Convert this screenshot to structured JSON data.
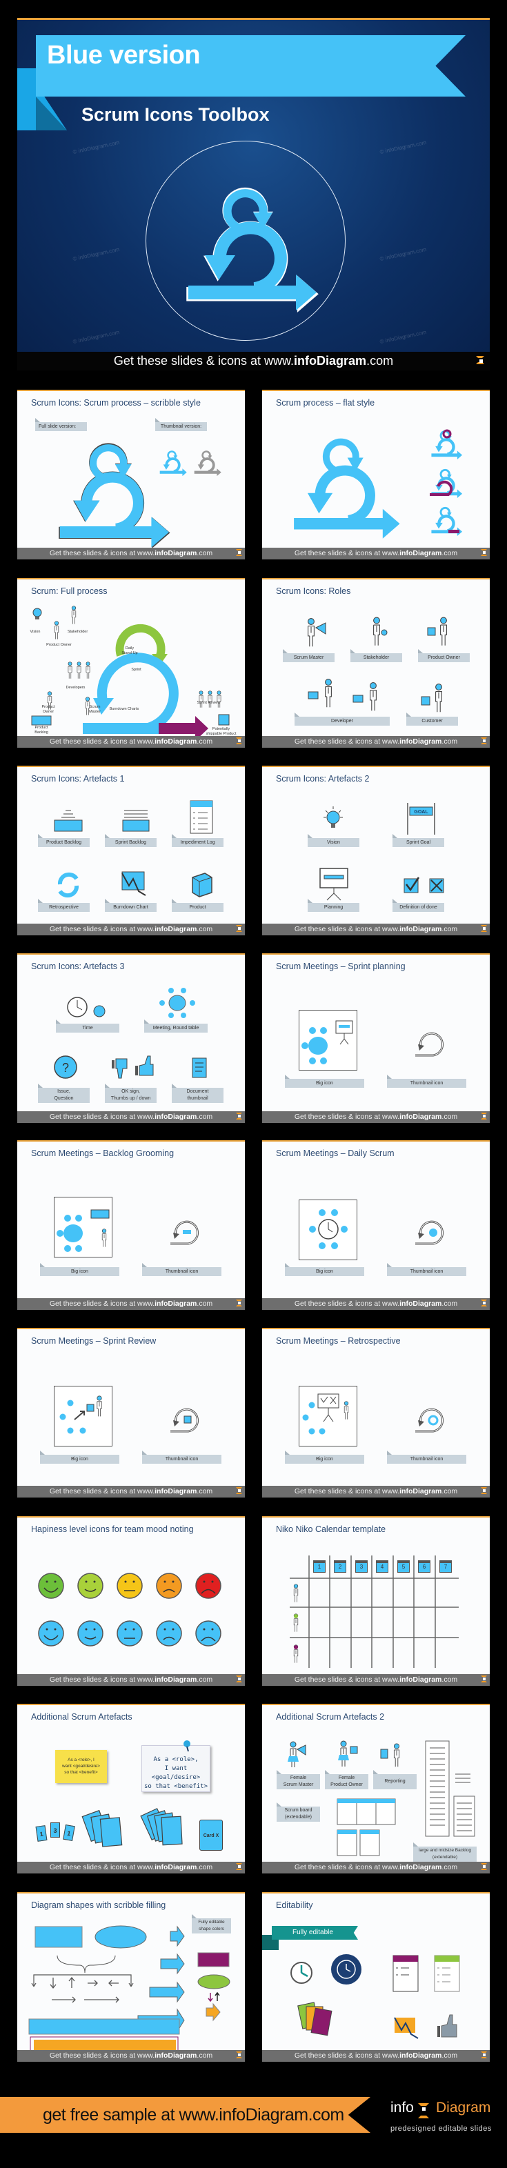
{
  "hero": {
    "title": "Blue version",
    "subtitle": "Scrum Icons Toolbox",
    "watermark": "© infoDiagram.com",
    "footer": {
      "prefix": "Get these slides & icons at www.",
      "brand": "infoDiagram",
      "suffix": ".com"
    }
  },
  "slide_footer": {
    "prefix": "Get these slides & icons at www.",
    "brand": "infoDiagram",
    "suffix": ".com"
  },
  "slides": [
    {
      "title": "Scrum Icons: Scrum process – scribble style",
      "labels": [
        "Full slide version:",
        "Thumbnail version:"
      ]
    },
    {
      "title": "Scrum process – flat style"
    },
    {
      "title": "Scrum: Full process",
      "labels": [
        "Vision",
        "Stakeholder",
        "Product Owner",
        "Daily\nStand-Up",
        "Developers",
        "Sprint",
        "Product\nOwner",
        "Scrum\nMaster",
        "Burndown Charts",
        "Sprint Review",
        "Product\nBacklog",
        "Potentially\nshippable Product"
      ]
    },
    {
      "title": "Scrum Icons: Roles",
      "labels": [
        "Scrum Master",
        "Stakeholder",
        "Product Owner",
        "Developer",
        "Customer"
      ]
    },
    {
      "title": "Scrum Icons: Artefacts 1",
      "labels": [
        "Product Backlog",
        "Sprint Backlog",
        "Impediment Log",
        "Retrospective",
        "Burndown Chart",
        "Product"
      ]
    },
    {
      "title": "Scrum Icons: Artefacts 2",
      "labels": [
        "Vision",
        "Sprint Goal",
        "Planning",
        "Definition of done"
      ],
      "goal_text": "GOAL"
    },
    {
      "title": "Scrum Icons: Artefacts 3",
      "labels": [
        "Time",
        "Meeting, Round table",
        "Issue,\nQuestion",
        "OK sign,\nThumbs up / down",
        "Document\nthumbnail"
      ]
    },
    {
      "title": "Scrum Meetings – Sprint planning",
      "labels": [
        "Big icon",
        "Thumbnail icon"
      ]
    },
    {
      "title": "Scrum Meetings – Backlog Grooming",
      "labels": [
        "Big icon",
        "Thumbnail icon"
      ]
    },
    {
      "title": "Scrum Meetings – Daily Scrum",
      "labels": [
        "Big icon",
        "Thumbnail icon"
      ]
    },
    {
      "title": "Scrum Meetings – Sprint Review",
      "labels": [
        "Big icon",
        "Thumbnail icon"
      ]
    },
    {
      "title": "Scrum Meetings – Retrospective",
      "labels": [
        "Big icon",
        "Thumbnail icon"
      ]
    },
    {
      "title": "Hapiness level icons for team mood noting"
    },
    {
      "title": "Niko Niko Calendar template",
      "days": [
        "1",
        "2",
        "3",
        "4",
        "5",
        "6",
        "7"
      ]
    },
    {
      "title": "Additional Scrum Artefacts",
      "sticky": "As a <role>, I\nwant <goal/desire>\nso that <benefit>",
      "note": "As a <role>,\nI want <goal/desire>\nso that <benefit>",
      "cards": [
        "1",
        "3",
        "1"
      ],
      "card_x": "Card X"
    },
    {
      "title": "Additional Scrum Artefacts 2",
      "labels": [
        "Female\nScrum Master",
        "Female\nProduct Owner",
        "Reporting",
        "Scrum board\n(extendable)",
        "large and midsize Backlog\n(extendable)"
      ]
    },
    {
      "title": "Diagram shapes with scribble filling",
      "labels": [
        "Fully editable\nshape colors"
      ]
    },
    {
      "title": "Editability",
      "labels": [
        "Fully editable"
      ]
    }
  ],
  "banner": {
    "text": "get free sample at www.infoDiagram.com",
    "logo_left": "info",
    "logo_right": "Diagram",
    "tagline": "predesigned editable slides"
  },
  "colors": {
    "accent_orange": "#f39a3c",
    "scrum_blue": "#45c2f7",
    "hero_bg": "#0d2f63",
    "purple": "#8b1a6b",
    "green": "#8dc63f",
    "tag_gray": "#c9d4dc",
    "moods": [
      "#6cbf3a",
      "#a9d13a",
      "#f5c518",
      "#f39a21",
      "#e02020"
    ]
  }
}
